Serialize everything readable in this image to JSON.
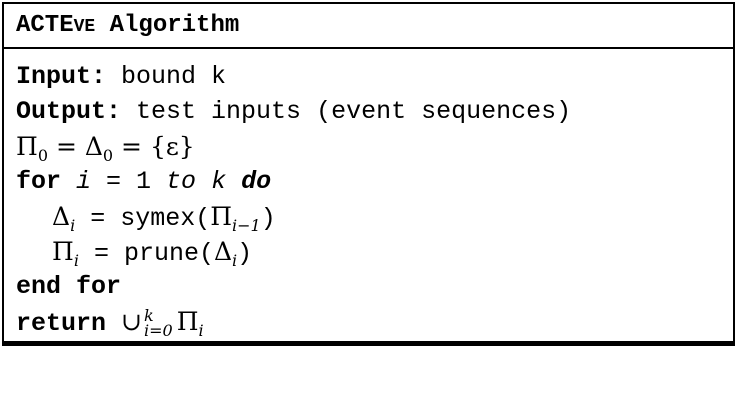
{
  "title": {
    "lead": "ACTE",
    "smallcaps": "VE",
    "rest": " Algorithm"
  },
  "lines": {
    "input_kw": "Input:",
    "input_text": " bound k",
    "output_kw": "Output:",
    "output_text": " test inputs (event sequences)",
    "init": {
      "pi": "Π",
      "pi_sub": "0",
      "eq1": " = ",
      "delta": "Δ",
      "delta_sub": "0",
      "eq2": " = ",
      "set": "{ε}"
    },
    "for_kw": "for",
    "for_var": " i",
    "for_mid": " = 1 ",
    "for_to": "to",
    "for_k": " k",
    "for_do": " do",
    "step1": {
      "delta": "Δ",
      "delta_sub": "i",
      "assign": " = symex(",
      "pi": "Π",
      "pi_sub": "i−1",
      "close": ")"
    },
    "step2": {
      "pi": "Π",
      "pi_sub": "i",
      "assign": " = prune(",
      "delta": "Δ",
      "delta_sub": "i",
      "close": ")"
    },
    "end_for": "end for",
    "return_kw": "return",
    "return_expr": {
      "union": "∪",
      "sup": "k",
      "sub": "i=0",
      "pi": "Π",
      "pi_sub": "i"
    }
  }
}
